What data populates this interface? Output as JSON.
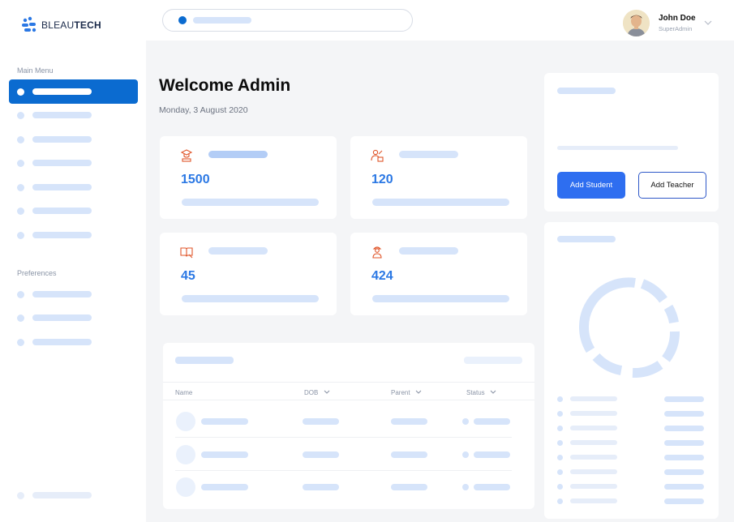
{
  "app": {
    "logo_text_light": "BLEAU",
    "logo_text_bold": "TECH"
  },
  "sidebar": {
    "main_menu_label": "Main Menu",
    "preferences_label": "Preferences"
  },
  "topbar": {
    "user_name": "John Doe",
    "user_role": "SuperAdmin"
  },
  "main": {
    "title": "Welcome Admin",
    "date": "Monday, 3 August 2020"
  },
  "stats": {
    "students": "1500",
    "teachers": "120",
    "courses": "45",
    "staff": "424"
  },
  "table": {
    "headers": [
      "Name",
      "DOB",
      "Parent",
      "Status"
    ]
  },
  "actions": {
    "add_student": "Add Student",
    "add_teacher": "Add Teacher"
  },
  "colors": {
    "accent": "#0b6bd0",
    "button_primary": "#2e6ef0",
    "stat_number": "#2b78e4",
    "skeleton": "#d6e4fa",
    "icon": "#e0562a"
  }
}
